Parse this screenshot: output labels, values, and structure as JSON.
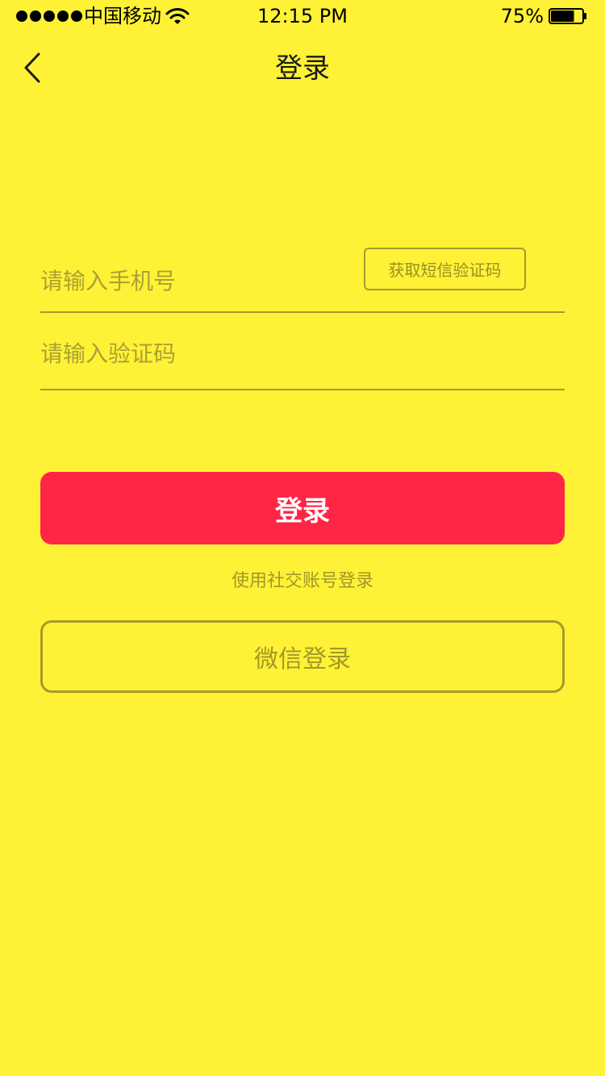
{
  "status_bar": {
    "carrier": "中国移动",
    "time": "12:15 PM",
    "battery": "75%",
    "battery_level": 0.75
  },
  "nav": {
    "title": "登录",
    "back_icon": "chevron-left-icon"
  },
  "form": {
    "phone_placeholder": "请输入手机号",
    "sms_button_label": "获取短信验证码",
    "code_placeholder": "请输入验证码"
  },
  "login_button_label": "登录",
  "social_label": "使用社交账号登录",
  "wechat_button_label": "微信登录",
  "colors": {
    "background": "#FFF236",
    "primary": "#FF2645",
    "muted": "#A79A2A"
  }
}
